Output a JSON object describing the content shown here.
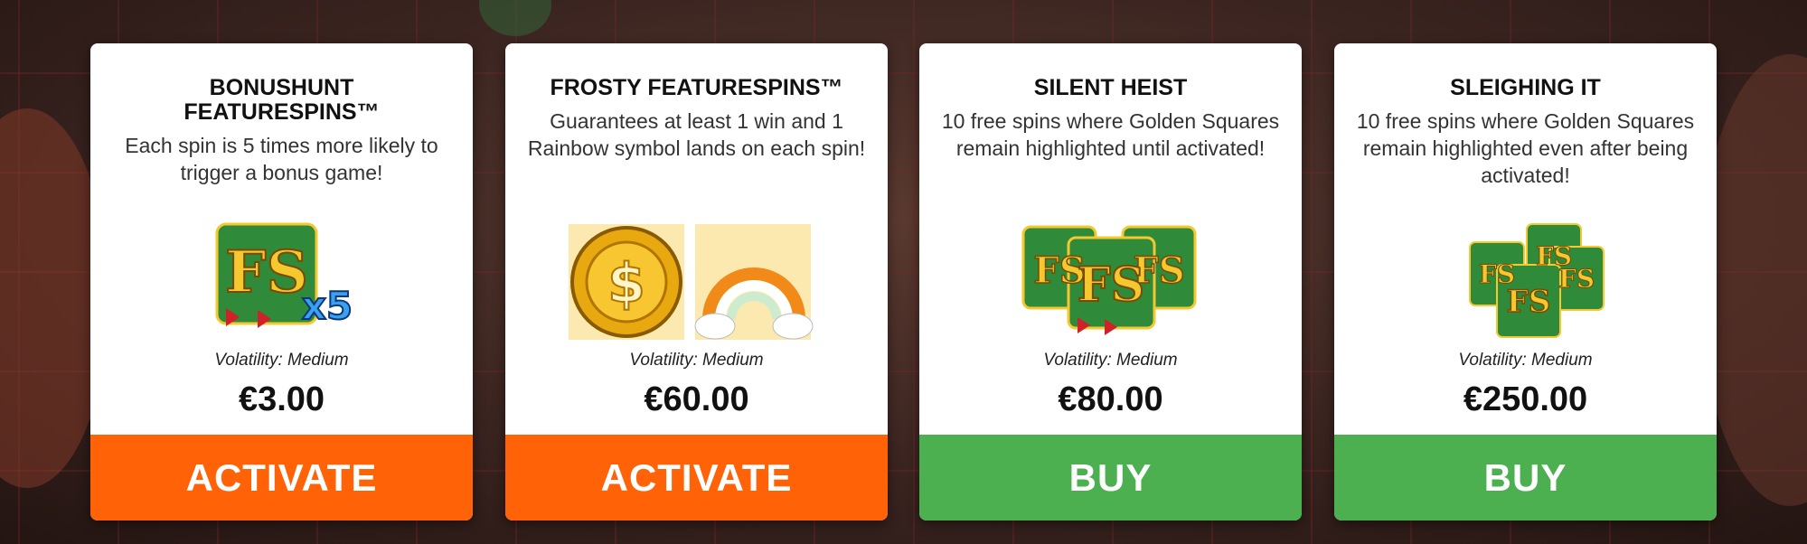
{
  "colors": {
    "activate": "#ff6207",
    "buy": "#4caf50"
  },
  "cards": [
    {
      "title": "BONUSHUNT FEATURESPINS™",
      "description": "Each spin is 5 times more likely to trigger a bonus game!",
      "icon": "fs-x5-icon",
      "icon_text": "FS",
      "multiplier": "x5",
      "volatility": "Volatility: Medium",
      "price": "€3.00",
      "button": "ACTIVATE"
    },
    {
      "title": "FROSTY FEATURESPINS™",
      "description": "Guarantees at least 1 win and 1 Rainbow symbol lands on each spin!",
      "icon": "coin-and-rainbow-icon",
      "coin_text": "$",
      "volatility": "Volatility: Medium",
      "price": "€60.00",
      "button": "ACTIVATE"
    },
    {
      "title": "SILENT HEIST",
      "description": "10 free spins where Golden Squares remain highlighted until activated!",
      "icon": "fs-triple-icon",
      "icon_text": "FS",
      "volatility": "Volatility: Medium",
      "price": "€80.00",
      "button": "BUY"
    },
    {
      "title": "SLEIGHING IT",
      "description": "10 free spins where Golden Squares remain highlighted even after being activated!",
      "icon": "fs-stack-icon",
      "icon_text": "FS",
      "volatility": "Volatility: Medium",
      "price": "€250.00",
      "button": "BUY"
    }
  ]
}
